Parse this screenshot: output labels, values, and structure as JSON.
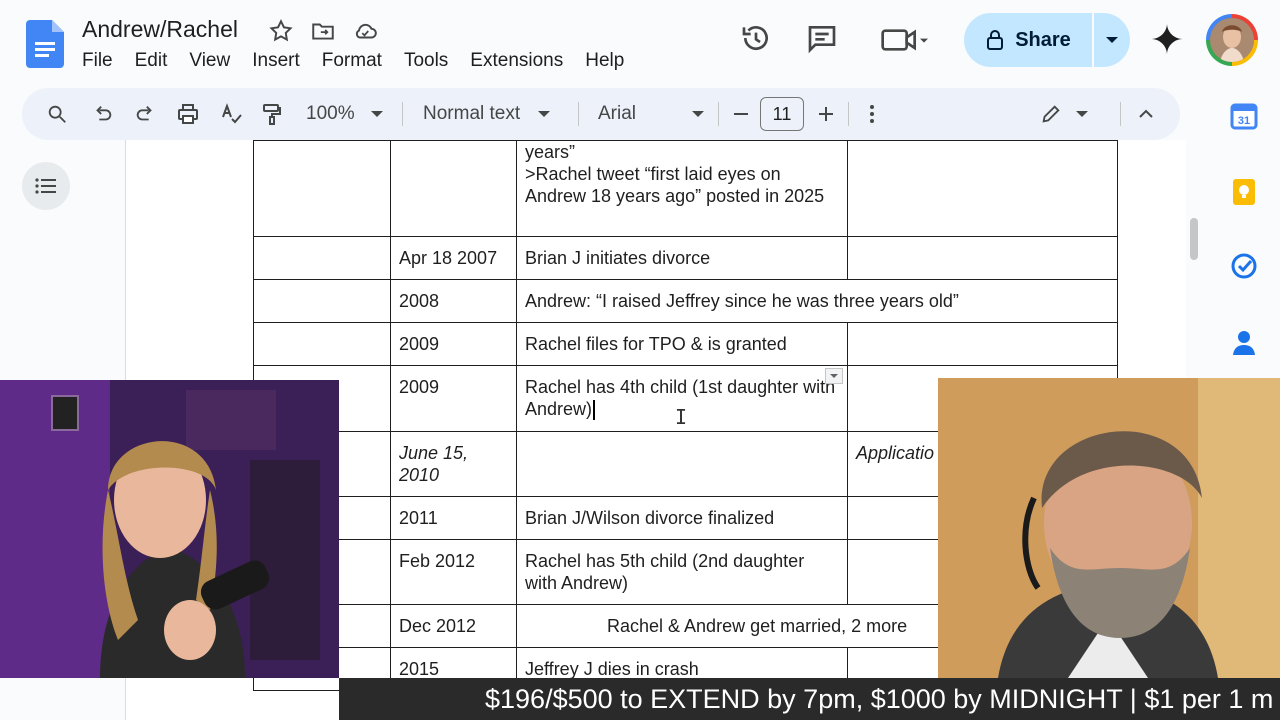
{
  "doc": {
    "title": "Andrew/Rachel"
  },
  "menu": [
    "File",
    "Edit",
    "View",
    "Insert",
    "Format",
    "Tools",
    "Extensions",
    "Help"
  ],
  "header": {
    "share_label": "Share"
  },
  "toolbar": {
    "zoom": "100%",
    "style": "Normal text",
    "font": "Arial",
    "font_size": "11"
  },
  "table": {
    "rows": [
      {
        "date": "",
        "event": "years”\n>Rachel tweet “first laid eyes on Andrew 18 years ago” posted in 2025",
        "notes": ""
      },
      {
        "date": "Apr 18 2007",
        "event": "Brian J initiates divorce",
        "notes": ""
      },
      {
        "date": "2008",
        "event": "Andrew: “I raised Jeffrey since he was three years old”",
        "notes": ""
      },
      {
        "date": "2009",
        "event": "Rachel files for TPO & is granted",
        "notes": ""
      },
      {
        "date": "2009",
        "event": "Rachel has 4th child (1st daughter with Andrew)",
        "notes": ""
      },
      {
        "date": "June 15, 2010",
        "event": "",
        "notes": "Applicatio"
      },
      {
        "date": "2011",
        "event": "Brian J/Wilson divorce finalized",
        "notes": ""
      },
      {
        "date": "Feb 2012",
        "event": "Rachel has 5th child (2nd daughter with Andrew)",
        "notes": ""
      },
      {
        "date": "Dec 2012",
        "event": "Rachel & Andrew get married, 2 more",
        "notes": ""
      },
      {
        "date": "2015",
        "event": "Jeffrey J dies in crash",
        "notes": ""
      }
    ]
  },
  "ticker": {
    "text": "$196/$500 to EXTEND by 7pm, $1000 by MIDNIGHT | $1 per 1 m"
  },
  "icons": {
    "header": [
      "star-icon",
      "move-to-folder-icon",
      "cloud-saved-icon",
      "version-history-icon",
      "comments-icon",
      "meet-icon",
      "lock-icon",
      "gemini-icon"
    ],
    "toolbar": [
      "search-icon",
      "undo-icon",
      "redo-icon",
      "print-icon",
      "spellcheck-icon",
      "paint-format-icon",
      "minus-icon",
      "plus-icon",
      "more-vert-icon",
      "editing-pencil-icon",
      "collapse-chevron-icon"
    ],
    "side": [
      "calendar-icon",
      "keep-icon",
      "tasks-icon",
      "contacts-icon"
    ]
  },
  "colors": {
    "accent": "#1a73e8",
    "share_bg": "#c2e7ff",
    "toolbar_bg": "#edf2fa"
  }
}
